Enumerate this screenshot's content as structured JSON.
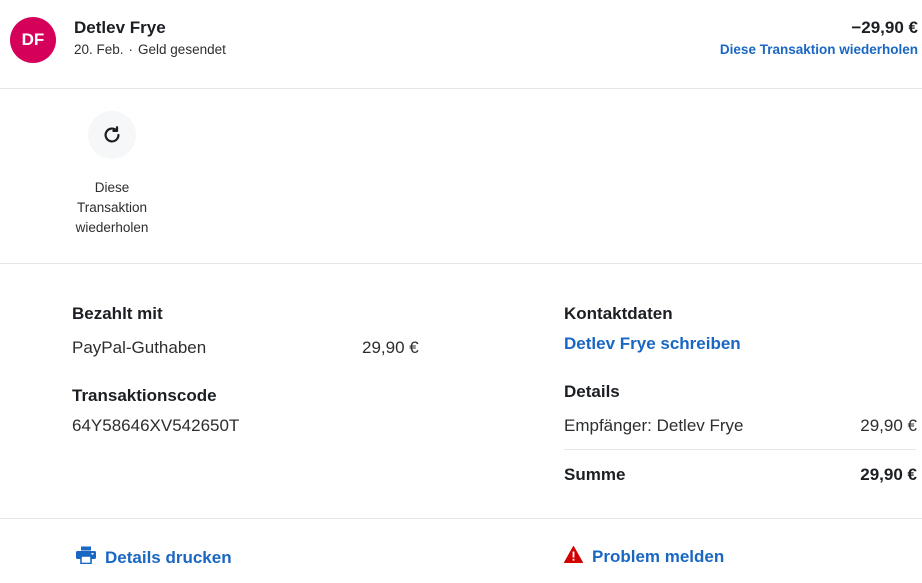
{
  "header": {
    "avatar_initials": "DF",
    "avatar_color": "#d4005a",
    "name": "Detlev Frye",
    "date": "20. Feb.",
    "separator": "·",
    "type": "Geld gesendet",
    "amount": "−29,90 €",
    "repeat_link": "Diese Transaktion wiederholen"
  },
  "actions": {
    "repeat": {
      "icon": "refresh-icon",
      "label_line1": "Diese",
      "label_line2": "Transaktion",
      "label_line3": "wiederholen"
    }
  },
  "payment": {
    "title": "Bezahlt mit",
    "method": "PayPal-Guthaben",
    "amount": "29,90 €"
  },
  "transaction": {
    "title": "Transaktionscode",
    "code": "64Y58646XV542650T"
  },
  "contact": {
    "title": "Kontaktdaten",
    "link": "Detlev Frye schreiben"
  },
  "details": {
    "title": "Details",
    "recipient_label": "Empfänger: Detlev Frye",
    "recipient_amount": "29,90 €",
    "total_label": "Summe",
    "total_amount": "29,90 €"
  },
  "footer": {
    "print_label": "Details drucken",
    "print_icon": "printer-icon",
    "report_label": "Problem melden",
    "report_icon": "warning-icon",
    "report_icon_color": "#d20000"
  },
  "colors": {
    "link": "#1a67c3",
    "divider": "#e3e6ea"
  }
}
